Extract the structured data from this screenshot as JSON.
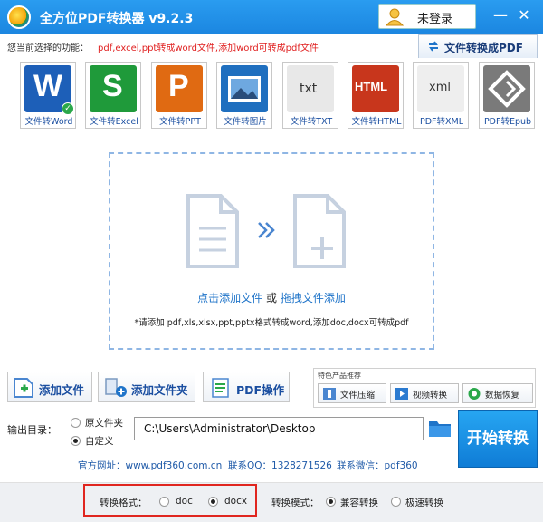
{
  "app": {
    "title": "全方位PDF转换器 v9.2.3",
    "login_label": "未登录"
  },
  "function_hint": {
    "label": "您当前选择的功能：",
    "value": "pdf,excel,ppt转成word文件,添加word可转成pdf文件"
  },
  "to_pdf_button": "文件转换成PDF",
  "tools": [
    {
      "label": "文件转Word",
      "glyph": "W",
      "bg": "#1d5fb8"
    },
    {
      "label": "文件转Excel",
      "glyph": "S",
      "bg": "#1f9a3a"
    },
    {
      "label": "文件转PPT",
      "glyph": "P",
      "bg": "#e06a12"
    },
    {
      "label": "文件转图片",
      "glyph": "",
      "bg": "#1f6fbf"
    },
    {
      "label": "文件转TXT",
      "glyph": "txt",
      "bg": "#e8e8e8"
    },
    {
      "label": "文件转HTML",
      "glyph": "HTML",
      "bg": "#c8361c"
    },
    {
      "label": "PDF转XML",
      "glyph": "xml",
      "bg": "#eeeeee"
    },
    {
      "label": "PDF转Epub",
      "glyph": "",
      "bg": "#7a7a7a"
    }
  ],
  "dropzone": {
    "click_add": "点击添加文件",
    "or": "或",
    "drag_add": "拖拽文件添加",
    "note": "*请添加 pdf,xls,xlsx,ppt,pptx格式转成word,添加doc,docx可转成pdf"
  },
  "actions": {
    "add_file": "添加文件",
    "add_folder": "添加文件夹",
    "pdf_ops": "PDF操作"
  },
  "featured": {
    "title": "特色产品推荐",
    "items": [
      "文件压缩",
      "视频转换",
      "数据恢复"
    ]
  },
  "output": {
    "label": "输出目录：",
    "options": [
      "原文件夹",
      "自定义"
    ],
    "selected": "自定义",
    "path": "C:\\Users\\Administrator\\Desktop"
  },
  "start_button": "开始转换",
  "contact": {
    "website": "官方网址：www.pdf360.com.cn",
    "qq": "联系QQ：1328271526",
    "wechat": "联系微信：pdf360"
  },
  "format": {
    "label": "转换格式：",
    "options": [
      "doc",
      "docx"
    ],
    "selected": "docx"
  },
  "mode": {
    "label": "转换模式：",
    "options": [
      "兼容转换",
      "极速转换"
    ],
    "selected": "兼容转换"
  },
  "colors": {
    "titlebar": "#1b86e0",
    "accent": "#1f74c9",
    "highlight_border": "#e0261f"
  }
}
